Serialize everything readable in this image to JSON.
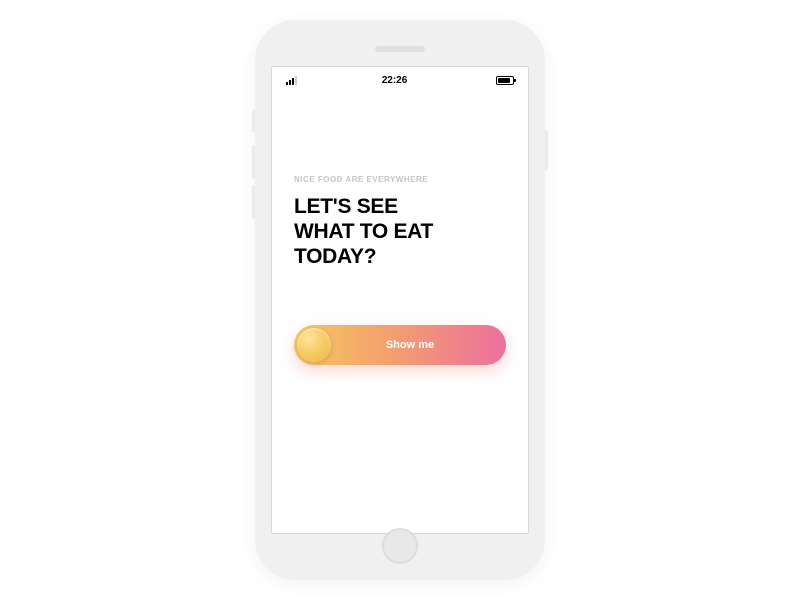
{
  "status_bar": {
    "time": "22:26"
  },
  "content": {
    "subtitle": "NICE FOOD ARE EVERYWHERE",
    "headline": "LET'S SEE\nWHAT TO EAT\nTODAY?"
  },
  "cta": {
    "label": "Show me"
  },
  "colors": {
    "gradient_start": "#f6c85f",
    "gradient_mid": "#f3a06e",
    "gradient_end": "#ed6f9e"
  }
}
